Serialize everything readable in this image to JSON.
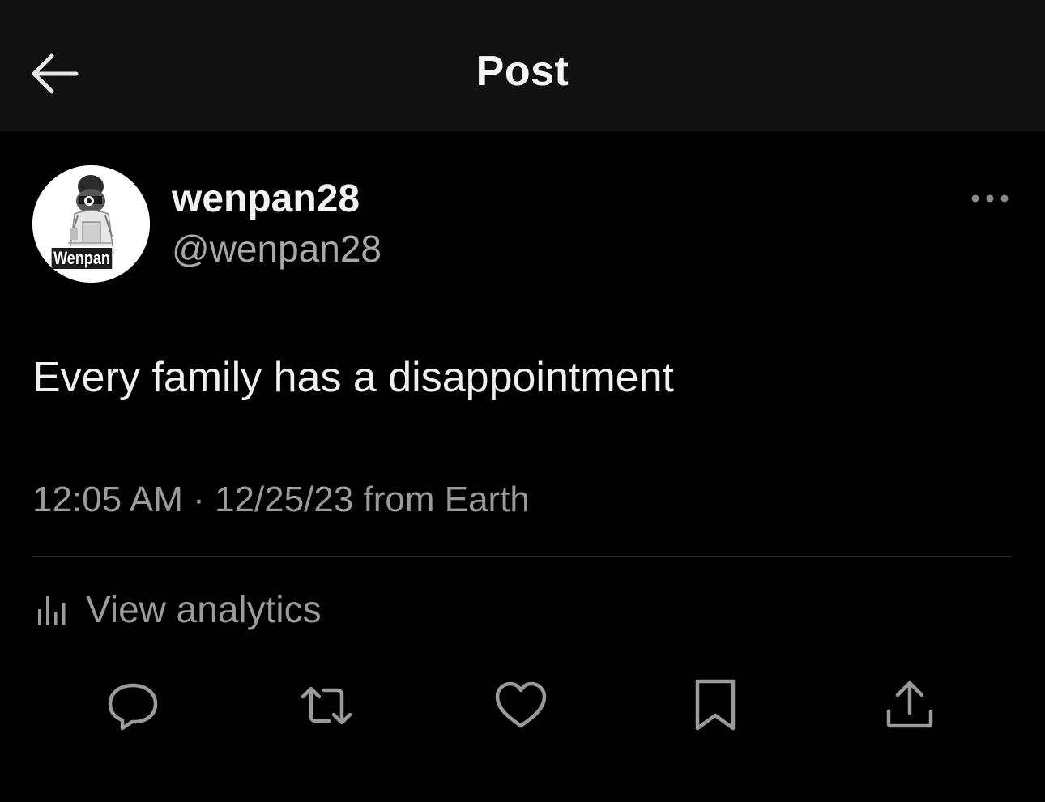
{
  "header": {
    "title": "Post",
    "back_icon": "arrow-left-icon"
  },
  "author": {
    "display_name": "wenpan28",
    "handle": "@wenpan28",
    "avatar_badge": "Wenpan"
  },
  "post": {
    "text": "Every family has a disappointment",
    "meta": "12:05 AM · 12/25/23 from Earth"
  },
  "analytics": {
    "label": "View analytics",
    "icon": "analytics-bars-icon"
  },
  "actions": [
    {
      "name": "reply",
      "icon": "reply-bubble-icon"
    },
    {
      "name": "repost",
      "icon": "repost-icon"
    },
    {
      "name": "like",
      "icon": "heart-icon"
    },
    {
      "name": "bookmark",
      "icon": "bookmark-icon"
    },
    {
      "name": "share",
      "icon": "share-icon"
    }
  ],
  "colors": {
    "background": "#000000",
    "header_background": "#111111",
    "primary_text": "#f0f0f0",
    "secondary_text": "#9a9a9a",
    "divider": "#2a2a2a"
  }
}
